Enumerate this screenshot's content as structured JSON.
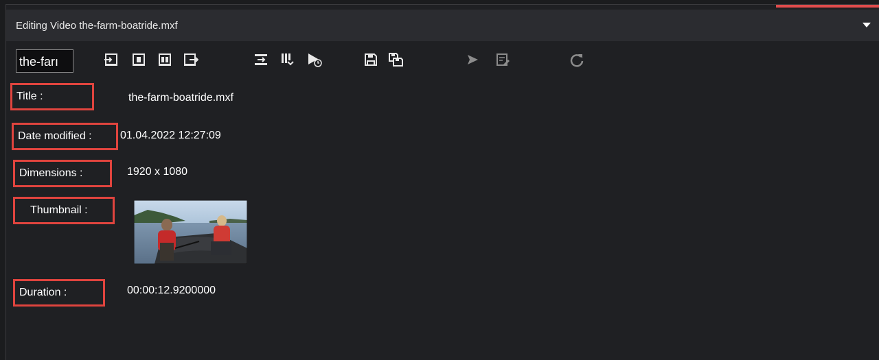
{
  "window": {
    "title": "Editing Video the-farm-boatride.mxf",
    "accent_color": "#e04c4c"
  },
  "toolbar": {
    "name_field_value": "the-farı",
    "icons": [
      "import-icon",
      "frame-icon",
      "split-frame-icon",
      "export-icon",
      "add-clip-icon",
      "columns-icon",
      "play-schedule-icon",
      "save-icon",
      "save-as-icon",
      "send-icon",
      "edit-document-icon",
      "refresh-icon"
    ]
  },
  "fields": {
    "title": {
      "label": "Title :",
      "value": "the-farm-boatride.mxf"
    },
    "date_modified": {
      "label": "Date modified :",
      "value": "01.04.2022 12:27:09"
    },
    "dimensions": {
      "label": "Dimensions :",
      "value": "1920 x 1080"
    },
    "thumbnail": {
      "label": "Thumbnail :"
    },
    "duration": {
      "label": "Duration :",
      "value": "00:00:12.9200000"
    }
  },
  "colors": {
    "background": "#1f2023",
    "titlebar": "#2b2c30",
    "highlight_border": "#e0443e"
  }
}
